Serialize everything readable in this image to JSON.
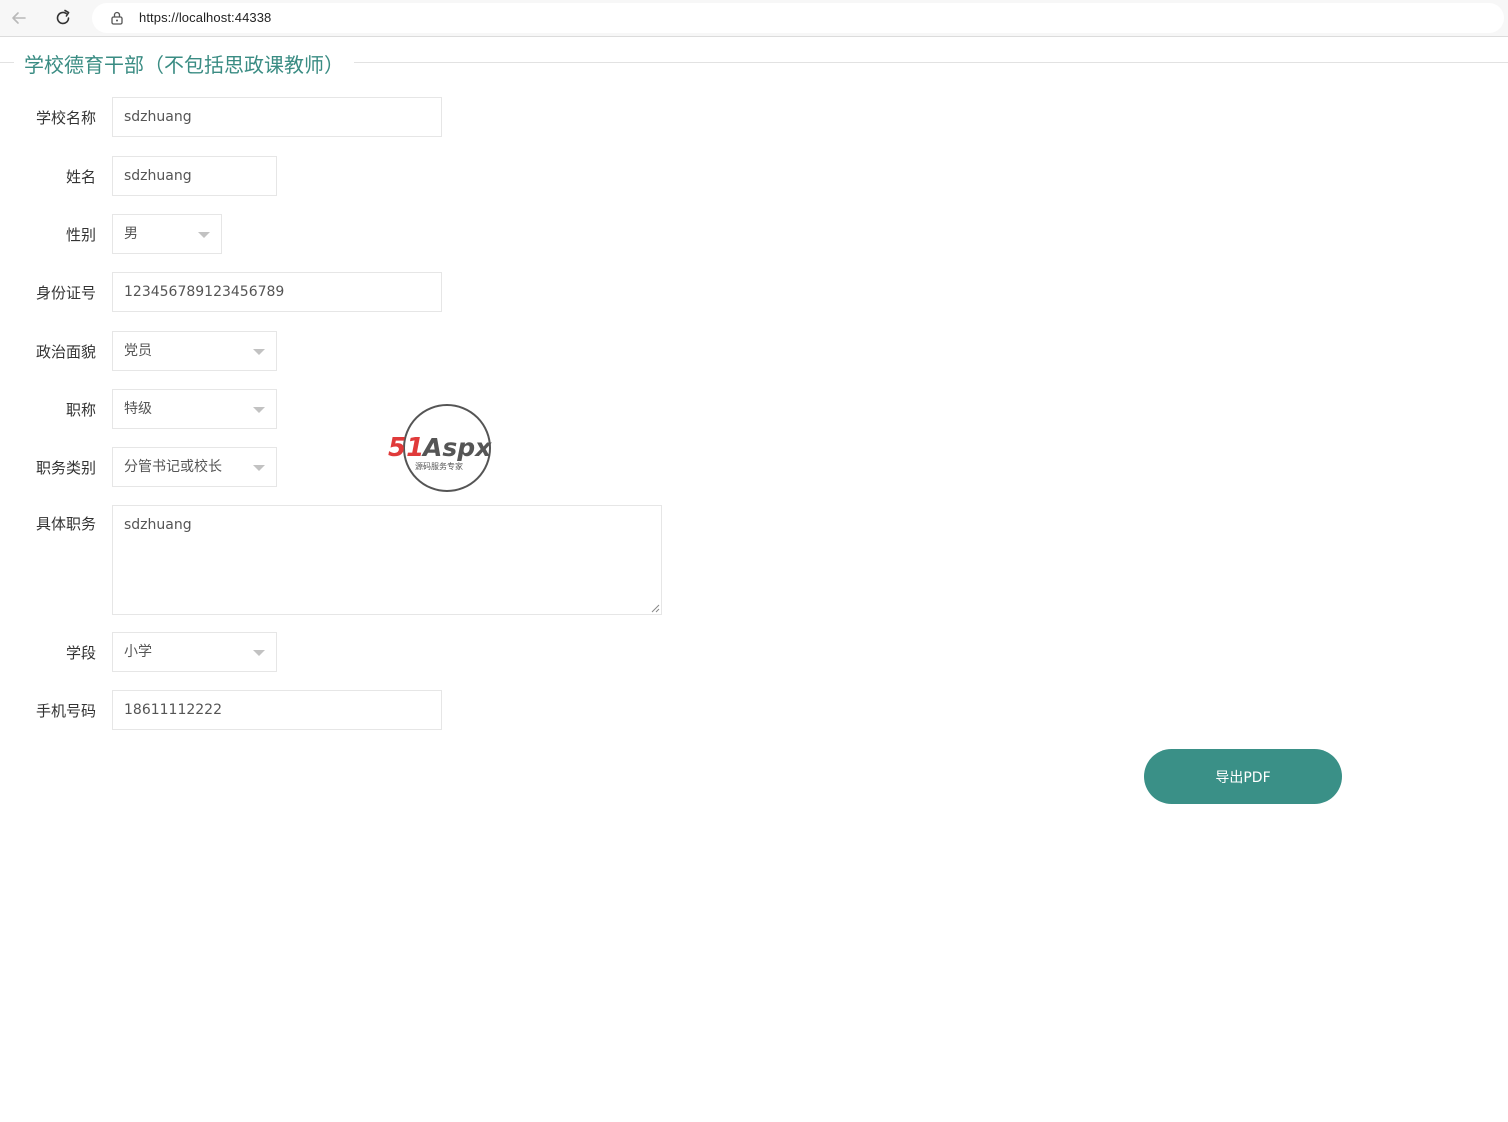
{
  "browser": {
    "url": "https://localhost:44338",
    "back_icon": "arrow-left-icon",
    "reload_icon": "reload-icon",
    "lock_icon": "lock-icon"
  },
  "form": {
    "legend": "学校德育干部（不包括思政课教师）",
    "fields": [
      {
        "label": "学校名称",
        "value": "sdzhuang",
        "type": "text"
      },
      {
        "label": "姓名",
        "value": "sdzhuang",
        "type": "text"
      },
      {
        "label": "性别",
        "value": "男",
        "type": "select"
      },
      {
        "label": "身份证号",
        "value": "123456789123456789",
        "type": "text"
      },
      {
        "label": "政治面貌",
        "value": "党员",
        "type": "select"
      },
      {
        "label": "职称",
        "value": "特级",
        "type": "select"
      },
      {
        "label": "职务类别",
        "value": "分管书记或校长",
        "type": "select"
      },
      {
        "label": "具体职务",
        "value": "sdzhuang",
        "type": "textarea"
      },
      {
        "label": "学段",
        "value": "小学",
        "type": "select"
      },
      {
        "label": "手机号码",
        "value": "18611112222",
        "type": "text"
      }
    ],
    "export_label": "导出PDF"
  },
  "watermark": {
    "brand_red": "51",
    "brand_dark": "Aspx",
    "tagline": "源码服务专家"
  },
  "colors": {
    "accent": "#3a9087",
    "legend": "#3a8c83",
    "border": "#e6e6e6"
  }
}
